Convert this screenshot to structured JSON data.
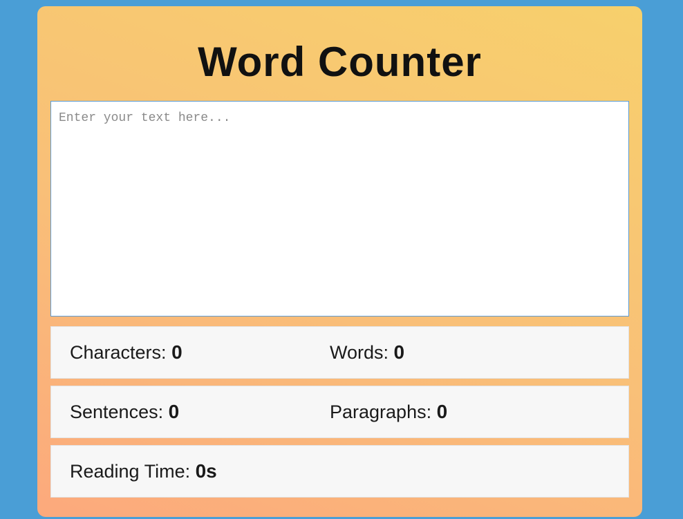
{
  "app": {
    "title": "Word Counter"
  },
  "editor": {
    "placeholder": "Enter your text here...",
    "value": ""
  },
  "stats": {
    "characters": {
      "label": "Characters:",
      "value": "0"
    },
    "words": {
      "label": "Words:",
      "value": "0"
    },
    "sentences": {
      "label": "Sentences:",
      "value": "0"
    },
    "paragraphs": {
      "label": "Paragraphs:",
      "value": "0"
    },
    "reading_time": {
      "label": "Reading Time:",
      "value": "0s"
    }
  },
  "colors": {
    "background": "#4a9ed6",
    "card_gradient_start": "#fca97c",
    "card_gradient_end": "#f7d06c",
    "stat_panel": "#f7f7f7",
    "input_border": "#5b9bd5"
  }
}
